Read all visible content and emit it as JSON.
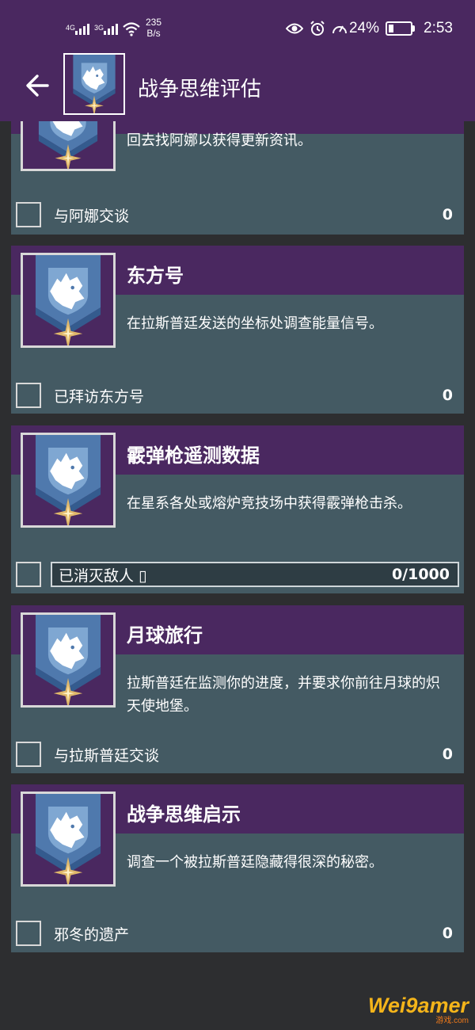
{
  "status_bar": {
    "signal1": "4G",
    "signal2": "3G",
    "net_speed": "235",
    "net_unit": "B/s",
    "battery": "24%",
    "battery_level": 0.24,
    "time": "2:53",
    "icons": [
      "eye-icon",
      "alarm-icon",
      "speedometer-icon",
      "battery-icon"
    ]
  },
  "app_bar": {
    "title": "战争思维评估",
    "back_icon": "arrow-left-icon",
    "emblem_icon": "wolf-banner-icon"
  },
  "quests": [
    {
      "title": "",
      "description": "回去找阿娜以获得更新资讯。",
      "objective": "与阿娜交谈",
      "count": "0",
      "type": "checkbox"
    },
    {
      "title": "东方号",
      "description": "在拉斯普廷发送的坐标处调查能量信号。",
      "objective": "已拜访东方号",
      "count": "0",
      "type": "checkbox"
    },
    {
      "title": "霰弹枪遥测数据",
      "description": "在星系各处或熔炉竞技场中获得霰弹枪击杀。",
      "objective": "已消灭敌人 ▯",
      "count": "0/1000",
      "progress": 0,
      "type": "progress"
    },
    {
      "title": "月球旅行",
      "description": "拉斯普廷在监测你的进度，并要求你前往月球的炽天使地堡。",
      "objective": "与拉斯普廷交谈",
      "count": "0",
      "type": "checkbox"
    },
    {
      "title": "战争思维启示",
      "description": "调查一个被拉斯普廷隐藏得很深的秘密。",
      "objective": "邪冬的遗产",
      "count": "0",
      "type": "checkbox"
    }
  ],
  "watermark": {
    "line1": "Wei9amer",
    "line2": "游戏.com"
  },
  "colors": {
    "purple": "#4a2860",
    "card": "#445a63",
    "background": "#2d2e30",
    "emblem_blue": "#4f79ad",
    "star_gold": "#e0b86a"
  }
}
